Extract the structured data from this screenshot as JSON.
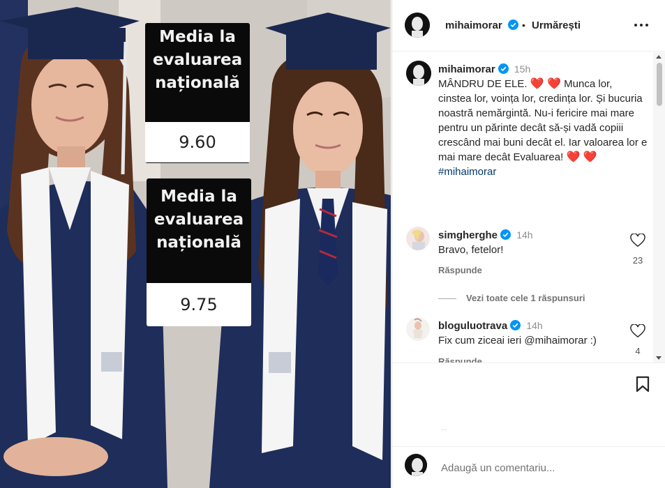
{
  "photo": {
    "cards": [
      {
        "title": "Media la evaluarea națională",
        "value": "9.60"
      },
      {
        "title": "Media la evaluarea națională",
        "value": "9.75"
      }
    ]
  },
  "header": {
    "username": "mihaimorar",
    "separator": "•",
    "follow_status": "Urmărești",
    "more_icon": "more-horizontal-icon"
  },
  "caption": {
    "username": "mihaimorar",
    "time": "15h",
    "text_before_hearts": "MÂNDRU DE ELE.",
    "text_middle": "Munca lor, cinstea lor, voința lor, credința lor. Și bucuria noastră nemărgintă. Nu-i fericire mai mare pentru un părinte decât să-și vadă copiii crescând mai buni decât el. Iar valoarea lor e mai mare decât Evaluarea!",
    "hearts": "❤️ ❤️",
    "hashtag": "#mihaimorar"
  },
  "comments": [
    {
      "username": "simgherghe",
      "time": "14h",
      "text": "Bravo, fetelor!",
      "reply_label": "Răspunde",
      "likes": "23"
    },
    {
      "username": "bloguluotrava",
      "time": "14h",
      "text": "Fix cum ziceai ieri @mihaimorar :)",
      "reply_label": "Răspunde",
      "likes": "4"
    }
  ],
  "view_replies": "Vezi toate cele 1 răspunsuri",
  "tiny_marker": "...",
  "add_comment": {
    "placeholder": "Adaugă un comentariu..."
  },
  "colors": {
    "verified": "#0095f6",
    "heart": "#e0142a",
    "hashtag": "#00376b",
    "gown": "#1e2d5a"
  }
}
